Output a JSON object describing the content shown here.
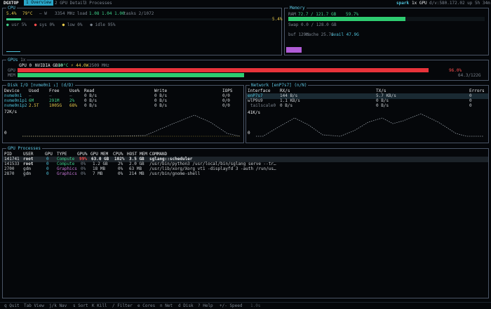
{
  "topbar": {
    "brand": "DGXTOP",
    "tabs": [
      "1 Overview",
      "2 GPU Detail",
      "3 Processes"
    ],
    "host": "spark",
    "gpu_count": "1x GPU",
    "sysinfo": "d/v:580.172.02  up 5h 34m"
  },
  "cpu": {
    "title": "CPU",
    "usage": "5.4%",
    "temp": "79°C",
    "power": "— W",
    "freq": "3354 MHz",
    "load_label": "load",
    "load_values": "1.08 1.04 1.00",
    "tasks": "tasks 2/1072",
    "bar_pct_label": "5.4%",
    "legend": [
      "usr 5%",
      "sys 0%",
      "low 0%",
      "idle 95%"
    ],
    "usage_fraction": 0.054
  },
  "memory": {
    "title": "Memory",
    "ram_label": "RAM",
    "ram_values": "72.7 / 121.7 GB",
    "ram_pct": "59.7%",
    "ram_fraction": 0.597,
    "swap": "Swap 0.0 / 128.0 GB",
    "buf": "buf 129M",
    "cache": "cache 25.7G",
    "avail": "avail 47.9G"
  },
  "gpus": {
    "title": "GPUs",
    "count": "1x",
    "gpu_id": "GPU 0",
    "name": "NVIDIA GB10",
    "temp": "69°C",
    "power": "⚡ 44.0W",
    "clock": "2509 MHz",
    "gpu_label": "GPU",
    "mem_label": "MEM",
    "util_pct": "96.0%",
    "util_fraction": 0.96,
    "mem_value": "64.3/122G",
    "mem_fraction": 0.53
  },
  "disk": {
    "title": "Disk I/O [nvme0n1 ↓] (d/D)",
    "headers": [
      "Device",
      "Used",
      "Free",
      "Use%",
      "Read",
      "Write",
      "IOPS"
    ],
    "rows": [
      [
        "nvme0n1",
        "—",
        "—",
        "—",
        "0 B/s",
        "0 B/s",
        "0/0"
      ],
      [
        "nvme0n1p1",
        "6M",
        "291M",
        "2%",
        "0 B/s",
        "0 B/s",
        "0/0"
      ],
      [
        "nvme0n1p2",
        "2.5T",
        "1005G",
        "68%",
        "0 B/s",
        "0 B/s",
        "0/0"
      ]
    ],
    "graph_max": "72K/s",
    "graph_min": "0"
  },
  "network": {
    "title": "Network [enP7s7] (n/N)",
    "headers": [
      "Interface",
      "RX/s",
      "TX/s",
      "Errors"
    ],
    "rows": [
      [
        "enP7s7",
        "144 B/s",
        "5.7 KB/s",
        "0"
      ],
      [
        "wlP9s9",
        "1.1 KB/s",
        "0 B/s",
        "0"
      ],
      [
        "tailscale0",
        "0 B/s",
        "0 B/s",
        "0"
      ]
    ],
    "graph_max": "41K/s",
    "graph_min": "0"
  },
  "processes": {
    "title": "GPU Processes",
    "headers": [
      "PID",
      "USER",
      "GPU",
      "TYPE",
      "GPU%",
      "GPU MEM",
      "CPU%",
      "HOST MEM",
      "COMMAND"
    ],
    "rows": [
      [
        "141741",
        "root",
        "0",
        "Compute",
        "99%",
        "63.0 GB",
        "102%",
        "3.5 GB",
        "sglang::scheduler"
      ],
      [
        "141533",
        "root",
        "0",
        "Compute",
        "0%",
        "1.2 GB",
        "2%",
        "2.0 GB",
        "/usr/bin/python3 /usr/local/bin/sglang serve --tr…"
      ],
      [
        "2700",
        "gdm",
        "0",
        "Graphics",
        "0%",
        "18 MB",
        "0%",
        "63 MB",
        "/usr/lib/xorg/Xorg vt1 -displayfd 3 -auth /run/us…"
      ],
      [
        "2870",
        "gdm",
        "0",
        "Graphics",
        "0%",
        "7 MB",
        "0%",
        "214 MB",
        "/usr/bin/gnome-shell"
      ]
    ]
  },
  "footer": {
    "items": [
      "q Quit",
      "Tab View",
      "j/k Nav",
      "s Sort",
      "K Kill",
      "/ Filter",
      "e Cores",
      "n Net",
      "d Disk",
      "? Help",
      "+/- Speed"
    ],
    "speed": "1.0s"
  },
  "colors": {
    "accent": "#4fc3dc",
    "ram_bar": "#2ecc71",
    "gpu_util_bar": "#e8333a",
    "gpu_mem_bar": "#2ecc71",
    "swap_indicator": "#b05cd6"
  }
}
